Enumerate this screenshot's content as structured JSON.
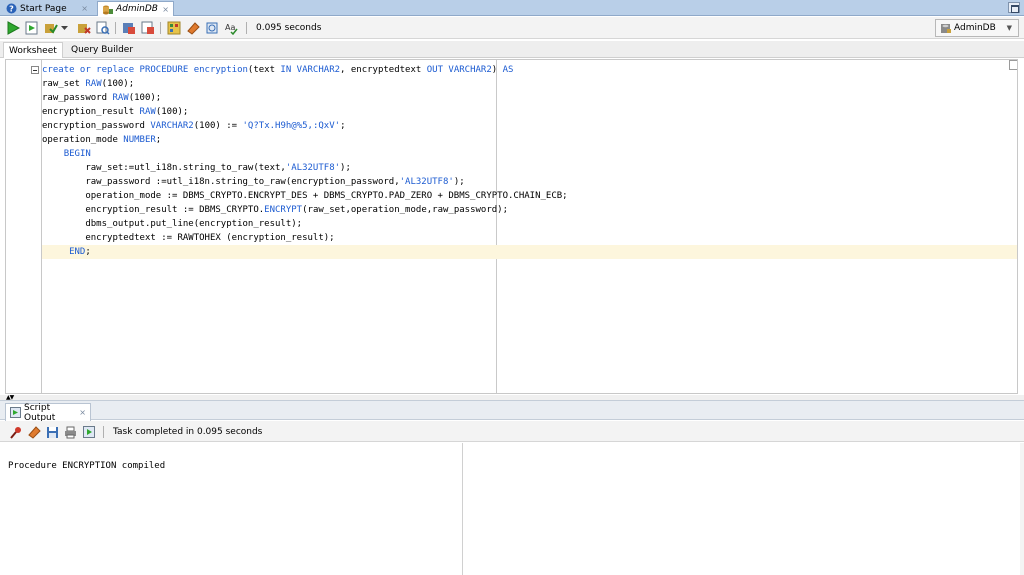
{
  "doc_tabs": [
    {
      "label": "Start Page",
      "icon": "help-icon"
    },
    {
      "label": "AdminDB",
      "icon": "database-icon"
    }
  ],
  "toolbar": {
    "elapsed": "0.095 seconds",
    "connection": "AdminDB"
  },
  "editor_tabs": [
    "Worksheet",
    "Query Builder"
  ],
  "code_lines": [
    [
      {
        "t": "create or replace PROCEDURE encryption",
        "c": "kw"
      },
      {
        "t": "(text "
      },
      {
        "t": "IN VARCHAR2",
        "c": "kw"
      },
      {
        "t": ", encryptedtext "
      },
      {
        "t": "OUT VARCHAR2",
        "c": "kw"
      },
      {
        "t": ") "
      },
      {
        "t": "AS",
        "c": "kw"
      }
    ],
    [
      {
        "t": "raw_set "
      },
      {
        "t": "RAW",
        "c": "kw"
      },
      {
        "t": "(100);"
      }
    ],
    [
      {
        "t": "raw_password "
      },
      {
        "t": "RAW",
        "c": "kw"
      },
      {
        "t": "(100);"
      }
    ],
    [
      {
        "t": "encryption_result "
      },
      {
        "t": "RAW",
        "c": "kw"
      },
      {
        "t": "(100);"
      }
    ],
    [
      {
        "t": "encryption_password "
      },
      {
        "t": "VARCHAR2",
        "c": "kw"
      },
      {
        "t": "(100) := "
      },
      {
        "t": "'Q?Tx.H9h@%5,:QxV'",
        "c": "str"
      },
      {
        "t": ";"
      }
    ],
    [
      {
        "t": "operation_mode "
      },
      {
        "t": "NUMBER",
        "c": "kw"
      },
      {
        "t": ";"
      }
    ],
    [
      {
        "t": "    "
      },
      {
        "t": "BEGIN",
        "c": "kw"
      }
    ],
    [
      {
        "t": "        raw_set:=utl_i18n.string_to_raw(text,"
      },
      {
        "t": "'AL32UTF8'",
        "c": "str"
      },
      {
        "t": ");"
      }
    ],
    [
      {
        "t": "        raw_password :=utl_i18n.string_to_raw(encryption_password,"
      },
      {
        "t": "'AL32UTF8'",
        "c": "str"
      },
      {
        "t": ");"
      }
    ],
    [
      {
        "t": "        operation_mode := DBMS_CRYPTO.ENCRYPT_DES + DBMS_CRYPTO.PAD_ZERO + DBMS_CRYPTO.CHAIN_ECB;"
      }
    ],
    [
      {
        "t": "        encryption_result := DBMS_CRYPTO."
      },
      {
        "t": "ENCRYPT",
        "c": "kw"
      },
      {
        "t": "(raw_set,operation_mode,raw_password);"
      }
    ],
    [
      {
        "t": "        dbms_output.put_line(encryption_result);"
      }
    ],
    [
      {
        "t": "        encryptedtext := RAWTOHEX (encryption_result);"
      }
    ],
    [
      {
        "t": "     "
      },
      {
        "t": "END",
        "c": "kw"
      },
      {
        "t": ";"
      }
    ]
  ],
  "current_line": 13,
  "output": {
    "tab_label": "Script Output",
    "status": "Task completed in 0.095 seconds",
    "text": "Procedure ENCRYPTION compiled"
  }
}
